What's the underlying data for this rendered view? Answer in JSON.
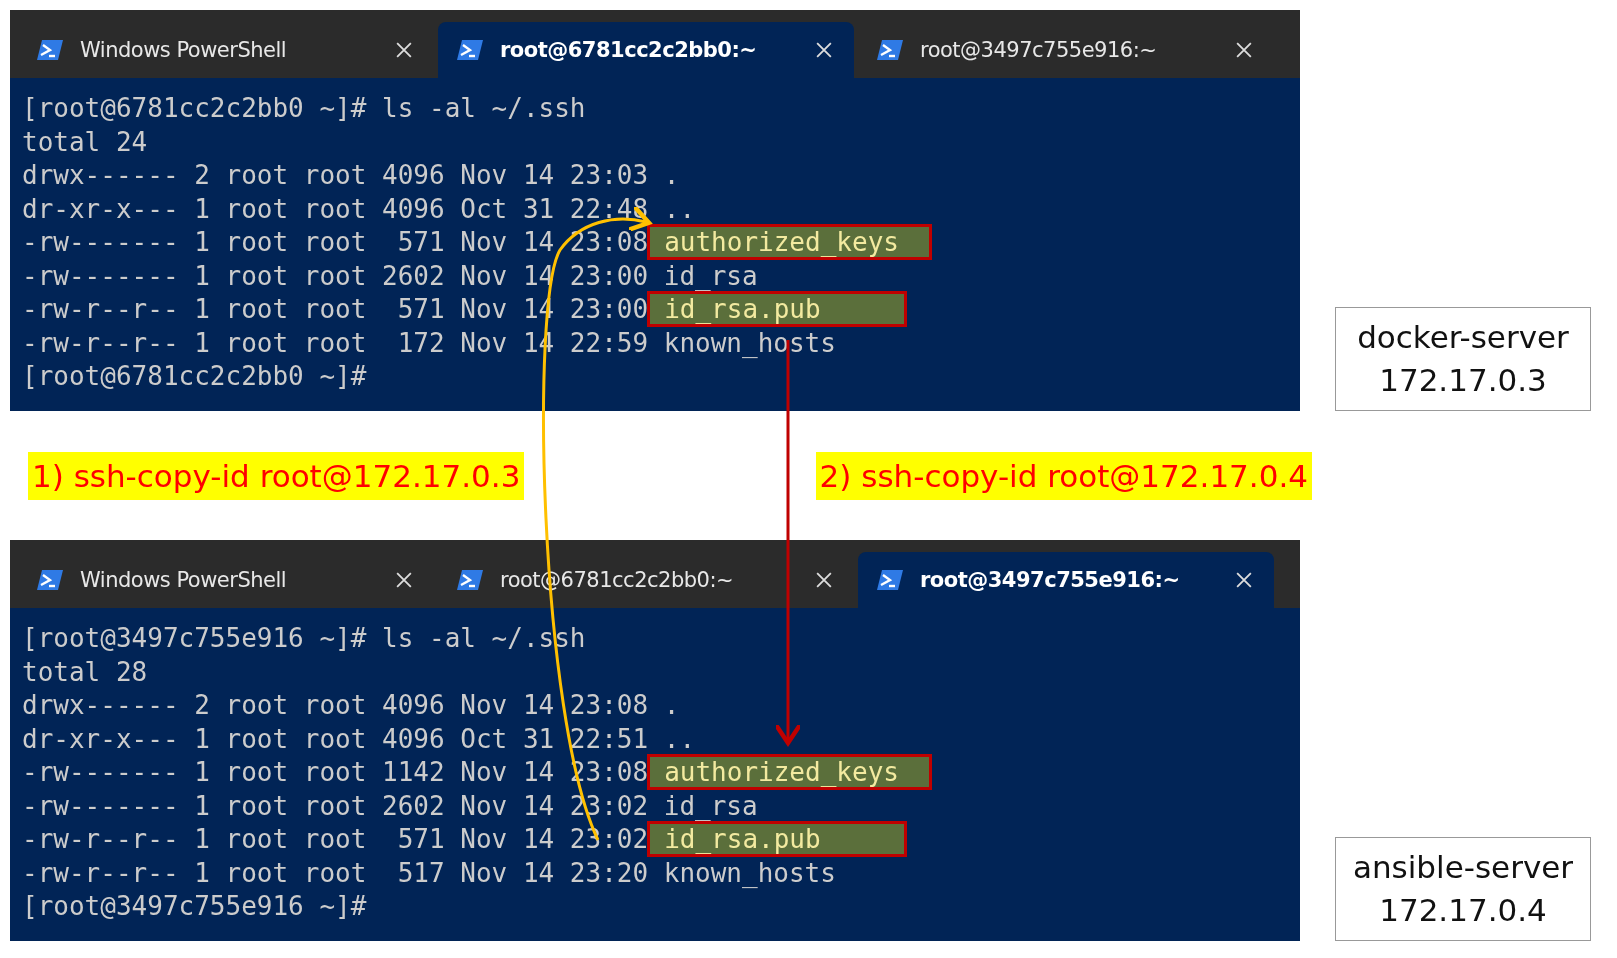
{
  "terminals": [
    {
      "tabs": [
        {
          "title": "Windows PowerShell",
          "selected": false
        },
        {
          "title": "root@6781cc2c2bb0:~",
          "selected": true
        },
        {
          "title": "root@3497c755e916:~",
          "selected": false
        }
      ],
      "lines": [
        {
          "kind": "text",
          "text": "[root@6781cc2c2bb0 ~]# ls -al ~/.ssh"
        },
        {
          "kind": "text",
          "text": "total 24"
        },
        {
          "kind": "entry",
          "info": "drwx------ 2 root root 4096 Nov 14 23:03",
          "name": ".",
          "highlighted": false
        },
        {
          "kind": "entry",
          "info": "dr-xr-x--- 1 root root 4096 Oct 31 22:48",
          "name": "..",
          "highlighted": false
        },
        {
          "kind": "entry",
          "info": "-rw------- 1 root root  571 Nov 14 23:08",
          "name": "authorized_keys",
          "highlighted": true
        },
        {
          "kind": "entry",
          "info": "-rw------- 1 root root 2602 Nov 14 23:00",
          "name": "id_rsa",
          "highlighted": false
        },
        {
          "kind": "entry",
          "info": "-rw-r--r-- 1 root root  571 Nov 14 23:00",
          "name": "id_rsa.pub",
          "highlighted": true
        },
        {
          "kind": "entry",
          "info": "-rw-r--r-- 1 root root  172 Nov 14 22:59",
          "name": "known_hosts",
          "highlighted": false
        },
        {
          "kind": "text",
          "text": "[root@6781cc2c2bb0 ~]#"
        }
      ],
      "server": {
        "name": "docker-server",
        "ip": "172.17.0.3"
      }
    },
    {
      "tabs": [
        {
          "title": "Windows PowerShell",
          "selected": false
        },
        {
          "title": "root@6781cc2c2bb0:~",
          "selected": false
        },
        {
          "title": "root@3497c755e916:~",
          "selected": true
        }
      ],
      "lines": [
        {
          "kind": "text",
          "text": "[root@3497c755e916 ~]# ls -al ~/.ssh"
        },
        {
          "kind": "text",
          "text": "total 28"
        },
        {
          "kind": "entry",
          "info": "drwx------ 2 root root 4096 Nov 14 23:08",
          "name": ".",
          "highlighted": false
        },
        {
          "kind": "entry",
          "info": "dr-xr-x--- 1 root root 4096 Oct 31 22:51",
          "name": "..",
          "highlighted": false
        },
        {
          "kind": "entry",
          "info": "-rw------- 1 root root 1142 Nov 14 23:08",
          "name": "authorized_keys",
          "highlighted": true
        },
        {
          "kind": "entry",
          "info": "-rw------- 1 root root 2602 Nov 14 23:02",
          "name": "id_rsa",
          "highlighted": false
        },
        {
          "kind": "entry",
          "info": "-rw-r--r-- 1 root root  571 Nov 14 23:02",
          "name": "id_rsa.pub",
          "highlighted": true
        },
        {
          "kind": "entry",
          "info": "-rw-r--r-- 1 root root  517 Nov 14 23:20",
          "name": "known_hosts",
          "highlighted": false
        },
        {
          "kind": "text",
          "text": "[root@3497c755e916 ~]#"
        }
      ],
      "server": {
        "name": "ansible-server",
        "ip": "172.17.0.4"
      }
    }
  ],
  "steps": [
    "1) ssh-copy-id root@172.17.0.3",
    "2) ssh-copy-id root@172.17.0.4"
  ]
}
